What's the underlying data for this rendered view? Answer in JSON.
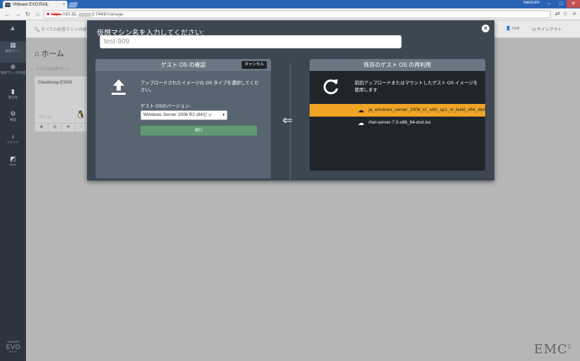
{
  "browser": {
    "tab_title": "VMware EVO:RAIL",
    "tab_favicon": "EVO",
    "window_user": "naozumi",
    "url_scheme": "https",
    "url_host_prefix": "://10.32.",
    "url_port": "2:7443",
    "url_path": "/manage"
  },
  "sidebar": {
    "logo_icon": "evo-logo-icon",
    "items": [
      {
        "icon": "grid-icon",
        "label": "仮想マシン"
      },
      {
        "icon": "plus-circle-icon",
        "label": "仮想マシンの作成"
      },
      {
        "icon": "bar-chart-icon",
        "label": "健全性"
      },
      {
        "icon": "gear-icon",
        "label": "構成"
      },
      {
        "icon": "bell-icon",
        "label": "イベント"
      },
      {
        "icon": "chart-icon",
        "label": "EVC"
      }
    ],
    "brand_top": "VMWARE",
    "brand_main": "EVO",
    "brand_bottom": "RAIL"
  },
  "app_topbar": {
    "search_placeholder": "すべての仮想マシンの検索",
    "user": "root",
    "signout": "サインアウト"
  },
  "main": {
    "title": "ホーム",
    "subtitle": "すべての仮想マシン",
    "vm_card": {
      "name": "CloudArray-ESXi5",
      "status": "パワーオン"
    },
    "brand": "EMC"
  },
  "modal": {
    "title": "仮想マシン名を入力してください:",
    "vm_name_value": "test-909",
    "left_panel": {
      "header": "ゲスト OS の確認",
      "cancel_label": "キャンセル",
      "description": "アップロードされたイメージの OS タイプを選択してください。",
      "version_label": "ゲスト OSのバージョン:",
      "version_selected": "Windows Server 2008 R2 (64ビッ",
      "go_label": "続行"
    },
    "right_panel": {
      "header": "既存のゲスト OS の再利用",
      "description": "前回アップロードまたはマウントしたゲスト OS イメージを使用します",
      "iso_items": [
        {
          "name": "ja_windows_server_2008_r2_with_sp1_vl_build_x64_dvd",
          "selected": true
        },
        {
          "name": "rhel-server-7.0-x86_64-dvd.iso",
          "selected": false
        }
      ]
    }
  },
  "colors": {
    "modal_bg": "#3d4752",
    "selected_row": "#f0a526",
    "go_button": "#5f9a72",
    "sidebar_bg": "#2c353f"
  }
}
